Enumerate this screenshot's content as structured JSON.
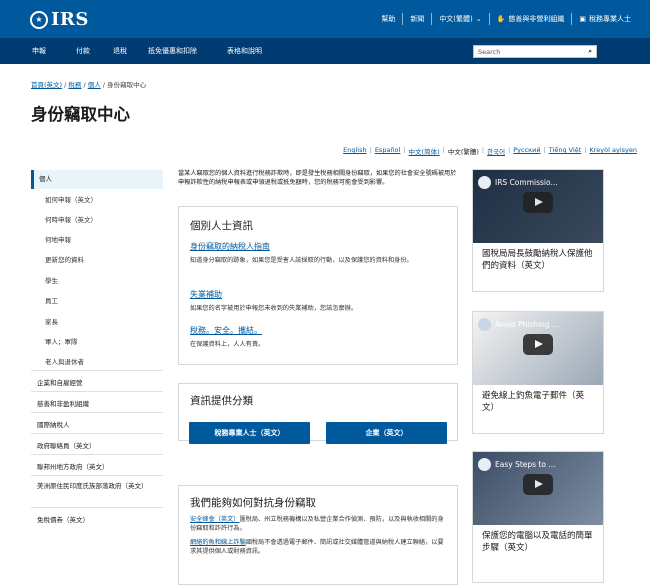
{
  "header": {
    "logo_text": "IRS",
    "links": [
      "幫助",
      "新聞",
      "中文(繁體)",
      "慈善與非營利組織",
      "稅務專業人士"
    ]
  },
  "nav": {
    "items": [
      "申報",
      "付款",
      "退稅",
      "抵免優惠和扣除",
      "表格和說明"
    ],
    "search_placeholder": "Search"
  },
  "breadcrumb": [
    "首頁(英文)",
    "稅務",
    "個人",
    "身份竊取中心"
  ],
  "page_title": "身份竊取中心",
  "languages": [
    "English",
    "Español",
    "中文(简体)",
    "中文(繁體)",
    "한국어",
    "Русский",
    "Tiếng Việt",
    "Kreyòl ayisyen"
  ],
  "sidebar": {
    "items": [
      "個人",
      "如何申報（英文）",
      "何時申報（英文）",
      "何地申報",
      "更新您的資料",
      "學生",
      "員工",
      "家長",
      "軍人；軍隊",
      "老人與退休者",
      "企業和自雇經營",
      "慈善和非盈利組織",
      "國際納稅人",
      "政府聯絡員（英文）",
      "聯邦州地方政府（英文）",
      "美洲原住民印度氏族部落政府（英文）",
      "免稅債券（英文）"
    ]
  },
  "intro_text": "當某人竊取您的個人資料進行稅務詐欺時，即是發生稅務相關身份竊取，如果您的社會安全號碼被用於申報詐欺性的納稅申報表或申領退稅或抵免額時，您的稅務可能會受到影響。",
  "individuals_card": {
    "title": "個別人士資訊",
    "links": [
      {
        "label": "身份竊取的納稅人指南",
        "desc": "知道身分竊取的跡象，如果您是受害人該採取的行動，以及保護您的資料和身份。"
      },
      {
        "label": "失業補助",
        "desc": "如果您的名字被用於申報您未收到的失業補助，您該怎麼辦。"
      },
      {
        "label": "稅務。安全。攜結。",
        "desc": "在保護資料上，人人有責。"
      }
    ]
  },
  "category_card": {
    "title": "資訊提供分類",
    "buttons": [
      "稅務專業人士（英文）",
      "企業（英文）"
    ]
  },
  "fight_card": {
    "title": "我們能夠如何對抗身份竊取",
    "items": [
      {
        "link": "安全峰會（英文）",
        "text": "匯稅局、州立稅務機構以及私營企業合作偵測、預防，以及與執收相關的身份竊取和詐許行為。"
      },
      {
        "link": "網絡釣魚和線上詐騙",
        "text": "國稅局不會透過電子郵件、簡訊或社交媒體管道與納稅人建立聯絡，以要求其提供個人或財務資訊。"
      }
    ]
  },
  "videos": [
    {
      "thumb_title": "IRS Commissio...",
      "caption": "國稅局局長鼓勵納稅人保護他們的資料（英文）"
    },
    {
      "thumb_title": "Avoid Phishing ...",
      "caption": "避免線上釣魚電子郵件（英文）"
    },
    {
      "thumb_title": "Easy Steps to ...",
      "caption": "保護您的電腦以及電話的簡單步驟（英文）"
    }
  ]
}
